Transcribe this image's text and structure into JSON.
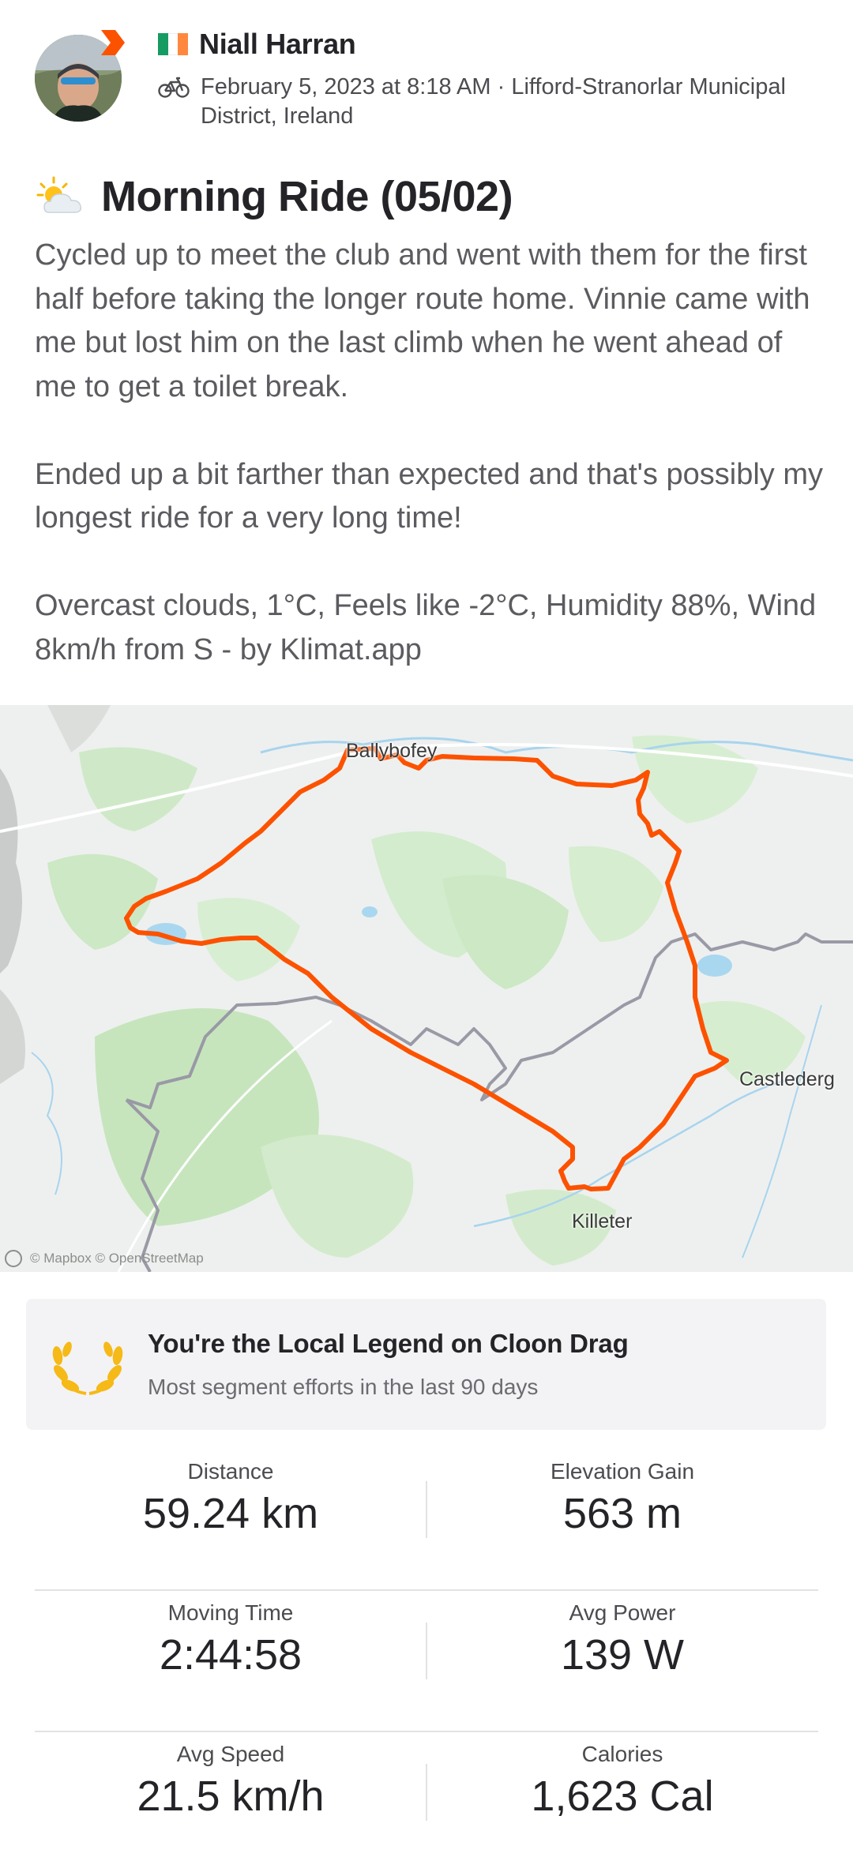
{
  "athlete": {
    "name": "Niall Harran",
    "flag_icon": "ireland-flag-icon",
    "activity_icon": "bike-icon",
    "date_location": "February 5, 2023 at 8:18 AM · Lifford-Stranorlar Municipal District, Ireland"
  },
  "activity": {
    "weather_icon": "sun-behind-cloud-icon",
    "title": "Morning Ride (05/02)",
    "description": [
      "Cycled up to meet the club and went with them for the first half before taking the longer route home. Vinnie came with me but lost him on the last climb when he went ahead of me to get a toilet break.",
      "Ended up a bit farther than expected and that's possibly my longest ride for a very long time!",
      "Overcast clouds, 1°C, Feels like -2°C, Humidity 88%, Wind 8km/h from S - by Klimat.app"
    ]
  },
  "map": {
    "places": [
      "Ballybofey",
      "Castlederg",
      "Killeter"
    ],
    "attribution": "© Mapbox © OpenStreetMap",
    "route_color": "#fc5200"
  },
  "local_legend": {
    "icon": "laurel-icon",
    "title": "You're the Local Legend on Cloon Drag",
    "subtitle": "Most segment efforts in the last 90 days"
  },
  "stats": [
    {
      "left": {
        "label": "Distance",
        "value": "59.24 km"
      },
      "right": {
        "label": "Elevation Gain",
        "value": "563 m"
      }
    },
    {
      "left": {
        "label": "Moving Time",
        "value": "2:44:58"
      },
      "right": {
        "label": "Avg Power",
        "value": "139 W"
      }
    },
    {
      "left": {
        "label": "Avg Speed",
        "value": "21.5 km/h"
      },
      "right": {
        "label": "Calories",
        "value": "1,623 Cal"
      }
    }
  ],
  "colors": {
    "brand": "#fc5200",
    "text_primary": "#242428",
    "text_secondary": "#5b5b60",
    "legend_gold": "#f5b918"
  }
}
